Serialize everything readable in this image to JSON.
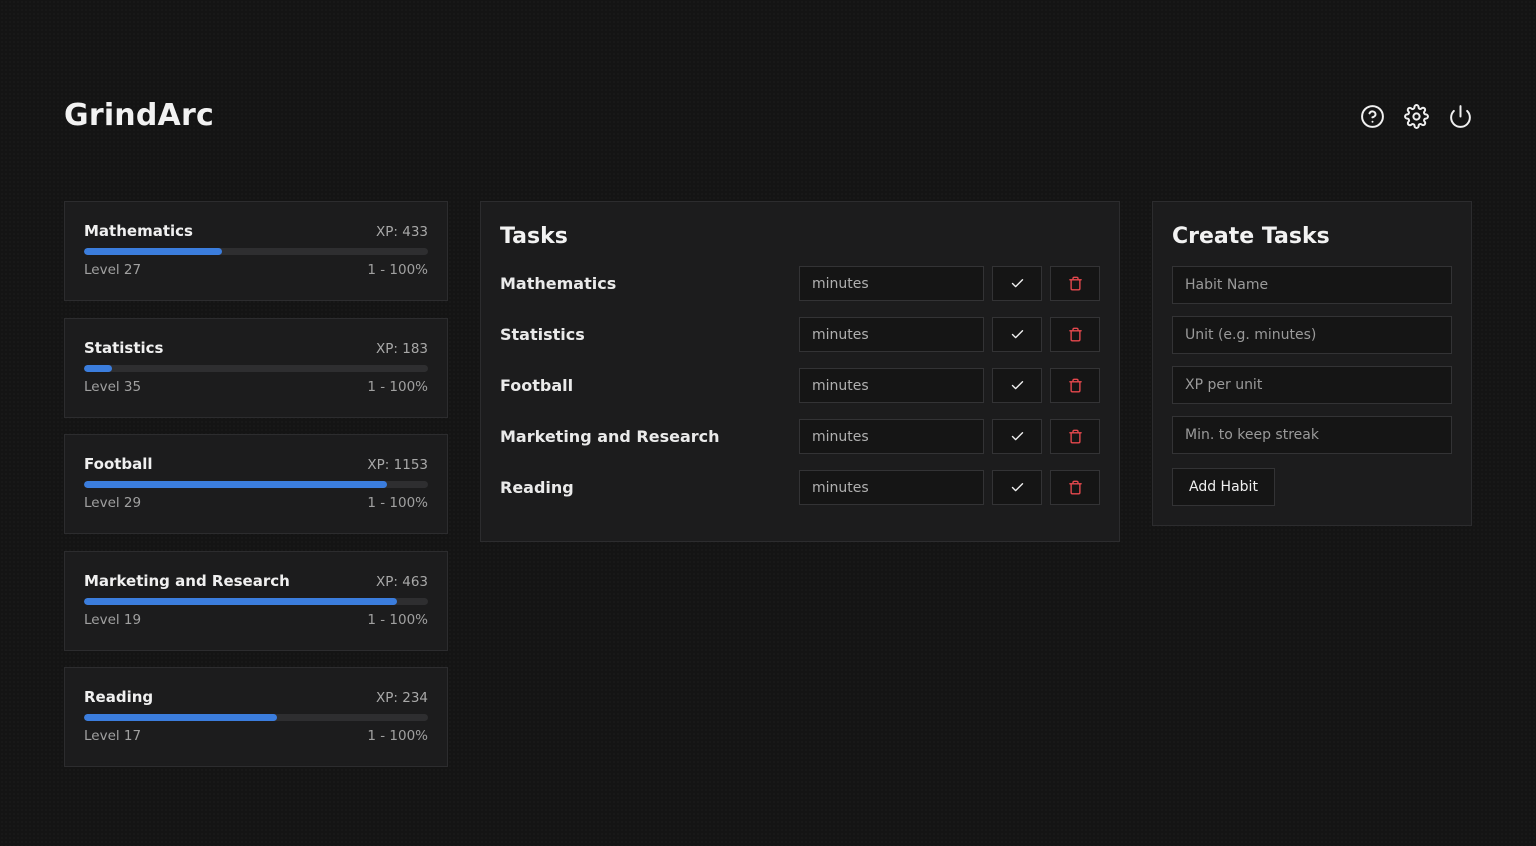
{
  "app": {
    "title": "GrindArc"
  },
  "header_icons": [
    "help-icon",
    "gear-icon",
    "power-icon"
  ],
  "colors": {
    "accent": "#3b7ddd",
    "danger": "#e5484d",
    "panel": "#1c1c1d",
    "background": "#141414"
  },
  "progress": [
    {
      "name": "Mathematics",
      "xp": "XP: 433",
      "level": "Level 27",
      "range": "1 - 100%",
      "fill_percent": 40
    },
    {
      "name": "Statistics",
      "xp": "XP: 183",
      "level": "Level 35",
      "range": "1 - 100%",
      "fill_percent": 8
    },
    {
      "name": "Football",
      "xp": "XP: 1153",
      "level": "Level 29",
      "range": "1 - 100%",
      "fill_percent": 88
    },
    {
      "name": "Marketing and Research",
      "xp": "XP: 463",
      "level": "Level 19",
      "range": "1 - 100%",
      "fill_percent": 91
    },
    {
      "name": "Reading",
      "xp": "XP: 234",
      "level": "Level 17",
      "range": "1 - 100%",
      "fill_percent": 56
    }
  ],
  "tasks": {
    "title": "Tasks",
    "items": [
      {
        "name": "Mathematics",
        "placeholder": "minutes"
      },
      {
        "name": "Statistics",
        "placeholder": "minutes"
      },
      {
        "name": "Football",
        "placeholder": "minutes"
      },
      {
        "name": "Marketing and Research",
        "placeholder": "minutes"
      },
      {
        "name": "Reading",
        "placeholder": "minutes"
      }
    ]
  },
  "create": {
    "title": "Create Tasks",
    "habit_name_placeholder": "Habit Name",
    "unit_placeholder": "Unit (e.g. minutes)",
    "xp_placeholder": "XP per unit",
    "streak_placeholder": "Min. to keep streak",
    "add_label": "Add Habit"
  }
}
